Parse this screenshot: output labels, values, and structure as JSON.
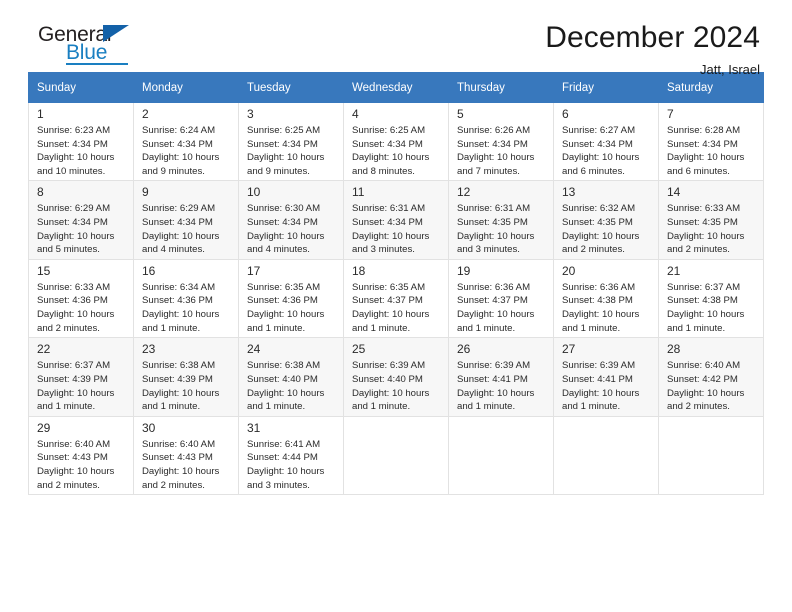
{
  "brand": {
    "name_top": "General",
    "name_bottom": "Blue",
    "accent_color": "#1a7fc1",
    "triangle_color": "#1361a8"
  },
  "header": {
    "title": "December 2024",
    "subtitle": "Jatt, Israel"
  },
  "calendar": {
    "header_bg": "#3878bd",
    "header_text_color": "#ffffff",
    "alt_row_bg": "#f7f7f7",
    "weekday_headers": [
      "Sunday",
      "Monday",
      "Tuesday",
      "Wednesday",
      "Thursday",
      "Friday",
      "Saturday"
    ],
    "weeks": [
      [
        {
          "day": "1",
          "sunrise": "Sunrise: 6:23 AM",
          "sunset": "Sunset: 4:34 PM",
          "daylight_line1": "Daylight: 10 hours",
          "daylight_line2": "and 10 minutes."
        },
        {
          "day": "2",
          "sunrise": "Sunrise: 6:24 AM",
          "sunset": "Sunset: 4:34 PM",
          "daylight_line1": "Daylight: 10 hours",
          "daylight_line2": "and 9 minutes."
        },
        {
          "day": "3",
          "sunrise": "Sunrise: 6:25 AM",
          "sunset": "Sunset: 4:34 PM",
          "daylight_line1": "Daylight: 10 hours",
          "daylight_line2": "and 9 minutes."
        },
        {
          "day": "4",
          "sunrise": "Sunrise: 6:25 AM",
          "sunset": "Sunset: 4:34 PM",
          "daylight_line1": "Daylight: 10 hours",
          "daylight_line2": "and 8 minutes."
        },
        {
          "day": "5",
          "sunrise": "Sunrise: 6:26 AM",
          "sunset": "Sunset: 4:34 PM",
          "daylight_line1": "Daylight: 10 hours",
          "daylight_line2": "and 7 minutes."
        },
        {
          "day": "6",
          "sunrise": "Sunrise: 6:27 AM",
          "sunset": "Sunset: 4:34 PM",
          "daylight_line1": "Daylight: 10 hours",
          "daylight_line2": "and 6 minutes."
        },
        {
          "day": "7",
          "sunrise": "Sunrise: 6:28 AM",
          "sunset": "Sunset: 4:34 PM",
          "daylight_line1": "Daylight: 10 hours",
          "daylight_line2": "and 6 minutes."
        }
      ],
      [
        {
          "day": "8",
          "sunrise": "Sunrise: 6:29 AM",
          "sunset": "Sunset: 4:34 PM",
          "daylight_line1": "Daylight: 10 hours",
          "daylight_line2": "and 5 minutes."
        },
        {
          "day": "9",
          "sunrise": "Sunrise: 6:29 AM",
          "sunset": "Sunset: 4:34 PM",
          "daylight_line1": "Daylight: 10 hours",
          "daylight_line2": "and 4 minutes."
        },
        {
          "day": "10",
          "sunrise": "Sunrise: 6:30 AM",
          "sunset": "Sunset: 4:34 PM",
          "daylight_line1": "Daylight: 10 hours",
          "daylight_line2": "and 4 minutes."
        },
        {
          "day": "11",
          "sunrise": "Sunrise: 6:31 AM",
          "sunset": "Sunset: 4:34 PM",
          "daylight_line1": "Daylight: 10 hours",
          "daylight_line2": "and 3 minutes."
        },
        {
          "day": "12",
          "sunrise": "Sunrise: 6:31 AM",
          "sunset": "Sunset: 4:35 PM",
          "daylight_line1": "Daylight: 10 hours",
          "daylight_line2": "and 3 minutes."
        },
        {
          "day": "13",
          "sunrise": "Sunrise: 6:32 AM",
          "sunset": "Sunset: 4:35 PM",
          "daylight_line1": "Daylight: 10 hours",
          "daylight_line2": "and 2 minutes."
        },
        {
          "day": "14",
          "sunrise": "Sunrise: 6:33 AM",
          "sunset": "Sunset: 4:35 PM",
          "daylight_line1": "Daylight: 10 hours",
          "daylight_line2": "and 2 minutes."
        }
      ],
      [
        {
          "day": "15",
          "sunrise": "Sunrise: 6:33 AM",
          "sunset": "Sunset: 4:36 PM",
          "daylight_line1": "Daylight: 10 hours",
          "daylight_line2": "and 2 minutes."
        },
        {
          "day": "16",
          "sunrise": "Sunrise: 6:34 AM",
          "sunset": "Sunset: 4:36 PM",
          "daylight_line1": "Daylight: 10 hours",
          "daylight_line2": "and 1 minute."
        },
        {
          "day": "17",
          "sunrise": "Sunrise: 6:35 AM",
          "sunset": "Sunset: 4:36 PM",
          "daylight_line1": "Daylight: 10 hours",
          "daylight_line2": "and 1 minute."
        },
        {
          "day": "18",
          "sunrise": "Sunrise: 6:35 AM",
          "sunset": "Sunset: 4:37 PM",
          "daylight_line1": "Daylight: 10 hours",
          "daylight_line2": "and 1 minute."
        },
        {
          "day": "19",
          "sunrise": "Sunrise: 6:36 AM",
          "sunset": "Sunset: 4:37 PM",
          "daylight_line1": "Daylight: 10 hours",
          "daylight_line2": "and 1 minute."
        },
        {
          "day": "20",
          "sunrise": "Sunrise: 6:36 AM",
          "sunset": "Sunset: 4:38 PM",
          "daylight_line1": "Daylight: 10 hours",
          "daylight_line2": "and 1 minute."
        },
        {
          "day": "21",
          "sunrise": "Sunrise: 6:37 AM",
          "sunset": "Sunset: 4:38 PM",
          "daylight_line1": "Daylight: 10 hours",
          "daylight_line2": "and 1 minute."
        }
      ],
      [
        {
          "day": "22",
          "sunrise": "Sunrise: 6:37 AM",
          "sunset": "Sunset: 4:39 PM",
          "daylight_line1": "Daylight: 10 hours",
          "daylight_line2": "and 1 minute."
        },
        {
          "day": "23",
          "sunrise": "Sunrise: 6:38 AM",
          "sunset": "Sunset: 4:39 PM",
          "daylight_line1": "Daylight: 10 hours",
          "daylight_line2": "and 1 minute."
        },
        {
          "day": "24",
          "sunrise": "Sunrise: 6:38 AM",
          "sunset": "Sunset: 4:40 PM",
          "daylight_line1": "Daylight: 10 hours",
          "daylight_line2": "and 1 minute."
        },
        {
          "day": "25",
          "sunrise": "Sunrise: 6:39 AM",
          "sunset": "Sunset: 4:40 PM",
          "daylight_line1": "Daylight: 10 hours",
          "daylight_line2": "and 1 minute."
        },
        {
          "day": "26",
          "sunrise": "Sunrise: 6:39 AM",
          "sunset": "Sunset: 4:41 PM",
          "daylight_line1": "Daylight: 10 hours",
          "daylight_line2": "and 1 minute."
        },
        {
          "day": "27",
          "sunrise": "Sunrise: 6:39 AM",
          "sunset": "Sunset: 4:41 PM",
          "daylight_line1": "Daylight: 10 hours",
          "daylight_line2": "and 1 minute."
        },
        {
          "day": "28",
          "sunrise": "Sunrise: 6:40 AM",
          "sunset": "Sunset: 4:42 PM",
          "daylight_line1": "Daylight: 10 hours",
          "daylight_line2": "and 2 minutes."
        }
      ],
      [
        {
          "day": "29",
          "sunrise": "Sunrise: 6:40 AM",
          "sunset": "Sunset: 4:43 PM",
          "daylight_line1": "Daylight: 10 hours",
          "daylight_line2": "and 2 minutes."
        },
        {
          "day": "30",
          "sunrise": "Sunrise: 6:40 AM",
          "sunset": "Sunset: 4:43 PM",
          "daylight_line1": "Daylight: 10 hours",
          "daylight_line2": "and 2 minutes."
        },
        {
          "day": "31",
          "sunrise": "Sunrise: 6:41 AM",
          "sunset": "Sunset: 4:44 PM",
          "daylight_line1": "Daylight: 10 hours",
          "daylight_line2": "and 3 minutes."
        },
        {
          "day": "",
          "sunrise": "",
          "sunset": "",
          "daylight_line1": "",
          "daylight_line2": ""
        },
        {
          "day": "",
          "sunrise": "",
          "sunset": "",
          "daylight_line1": "",
          "daylight_line2": ""
        },
        {
          "day": "",
          "sunrise": "",
          "sunset": "",
          "daylight_line1": "",
          "daylight_line2": ""
        },
        {
          "day": "",
          "sunrise": "",
          "sunset": "",
          "daylight_line1": "",
          "daylight_line2": ""
        }
      ]
    ]
  }
}
